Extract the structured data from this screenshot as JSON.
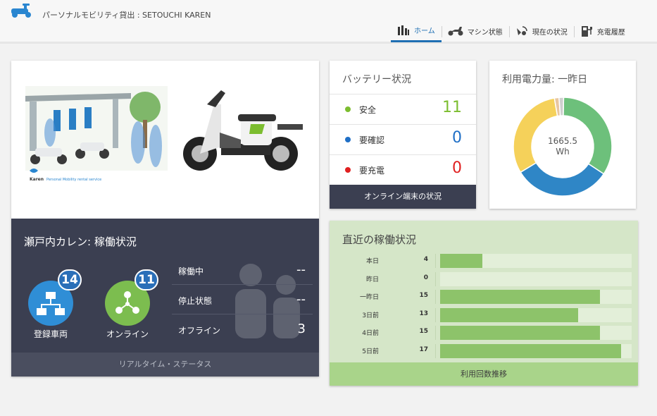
{
  "header": {
    "app_title": "パーソナルモビリティ貸出 : SETOUCHI KAREN",
    "logo_icon": "scooter-logo-icon",
    "nav": [
      {
        "label": "ホーム",
        "icon": "bar-chart-icon",
        "active": true
      },
      {
        "label": "マシン状態",
        "icon": "scooter-icon",
        "active": false
      },
      {
        "label": "現在の状況",
        "icon": "satellite-icon",
        "active": false
      },
      {
        "label": "充電履歴",
        "icon": "charging-station-icon",
        "active": false
      }
    ]
  },
  "overview": {
    "title": "瀬戸内カレン: 稼働状況",
    "registered": {
      "label": "登録車両",
      "count": "14"
    },
    "online": {
      "label": "オンライン",
      "count": "11"
    },
    "stats": [
      {
        "label": "稼働中",
        "value": "--"
      },
      {
        "label": "停止状態",
        "value": "--"
      },
      {
        "label": "オフライン",
        "value": "3"
      }
    ],
    "footer": "リアルタイム・ステータス",
    "illustration_brand": "Karen",
    "illustration_tagline": "Personal Mobility rental service"
  },
  "battery": {
    "title": "バッテリー状況",
    "rows": [
      {
        "label": "安全",
        "value": "11",
        "color": "#7cbd2f"
      },
      {
        "label": "要確認",
        "value": "0",
        "color": "#1f6fc6"
      },
      {
        "label": "要充電",
        "value": "0",
        "color": "#e02020"
      }
    ],
    "footer": "オンライン端末の状況"
  },
  "power": {
    "title": "利用電力量: 一昨日",
    "value_line1": "1665.5",
    "value_line2": "Wh",
    "segments": [
      {
        "value": 34,
        "color": "#6dc07b"
      },
      {
        "value": 32,
        "color": "#2f86c6"
      },
      {
        "value": 31,
        "color": "#f5d15a"
      },
      {
        "value": 1.5,
        "color": "#e8c6a0"
      },
      {
        "value": 1.5,
        "color": "#cfcfcf"
      }
    ]
  },
  "usage": {
    "title": "直近の稼働状況",
    "max": 18,
    "rows": [
      {
        "label": "本日",
        "value": 4
      },
      {
        "label": "昨日",
        "value": 0
      },
      {
        "label": "一昨日",
        "value": 15
      },
      {
        "label": "3日前",
        "value": 13
      },
      {
        "label": "4日前",
        "value": 15
      },
      {
        "label": "5日前",
        "value": 17
      }
    ],
    "footer": "利用回数推移"
  }
}
